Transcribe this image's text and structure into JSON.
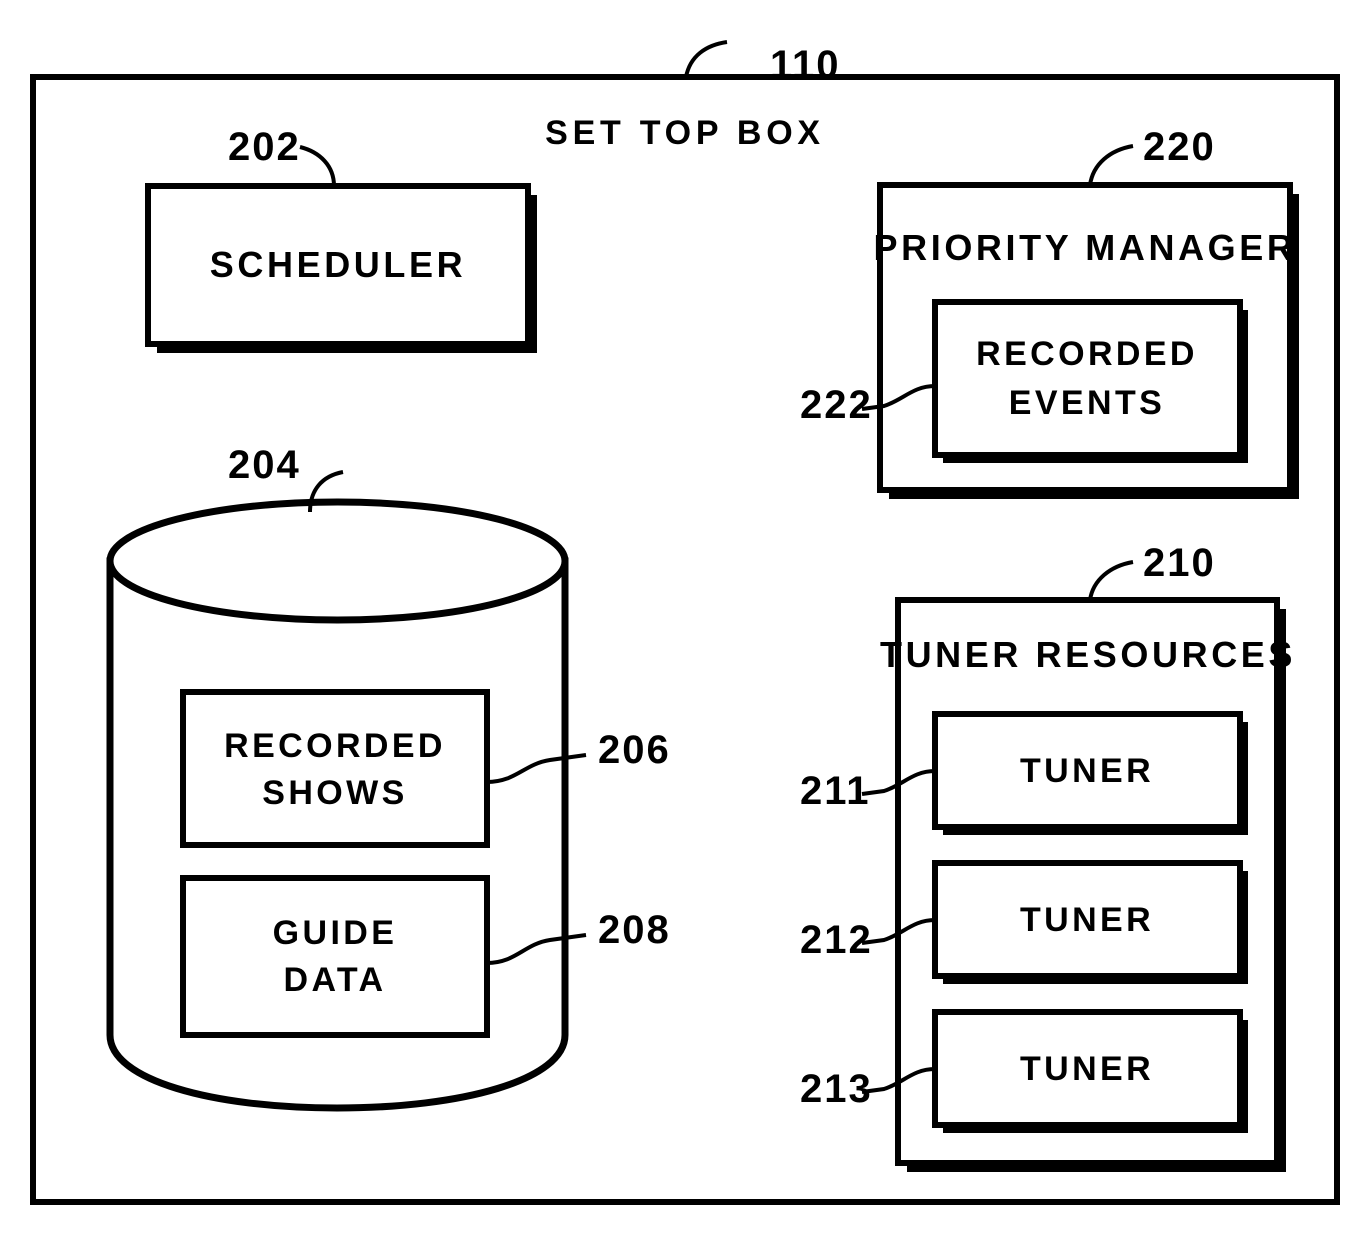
{
  "figure": {
    "outer_label": "110",
    "title": "SET TOP BOX",
    "stroke_color": "#000000",
    "fill_color": "#ffffff"
  },
  "blocks": {
    "scheduler": {
      "ref": "202",
      "label": "SCHEDULER"
    },
    "storage": {
      "ref": "204",
      "items": [
        {
          "ref": "206",
          "line1": "RECORDED",
          "line2": "SHOWS"
        },
        {
          "ref": "208",
          "line1": "GUIDE",
          "line2": "DATA"
        }
      ]
    },
    "priority_manager": {
      "ref": "220",
      "label": "PRIORITY MANAGER",
      "child": {
        "ref": "222",
        "line1": "RECORDED",
        "line2": "EVENTS"
      }
    },
    "tuner_resources": {
      "ref": "210",
      "label": "TUNER RESOURCES",
      "tuners": [
        {
          "ref": "211",
          "label": "TUNER"
        },
        {
          "ref": "212",
          "label": "TUNER"
        },
        {
          "ref": "213",
          "label": "TUNER"
        }
      ]
    }
  }
}
